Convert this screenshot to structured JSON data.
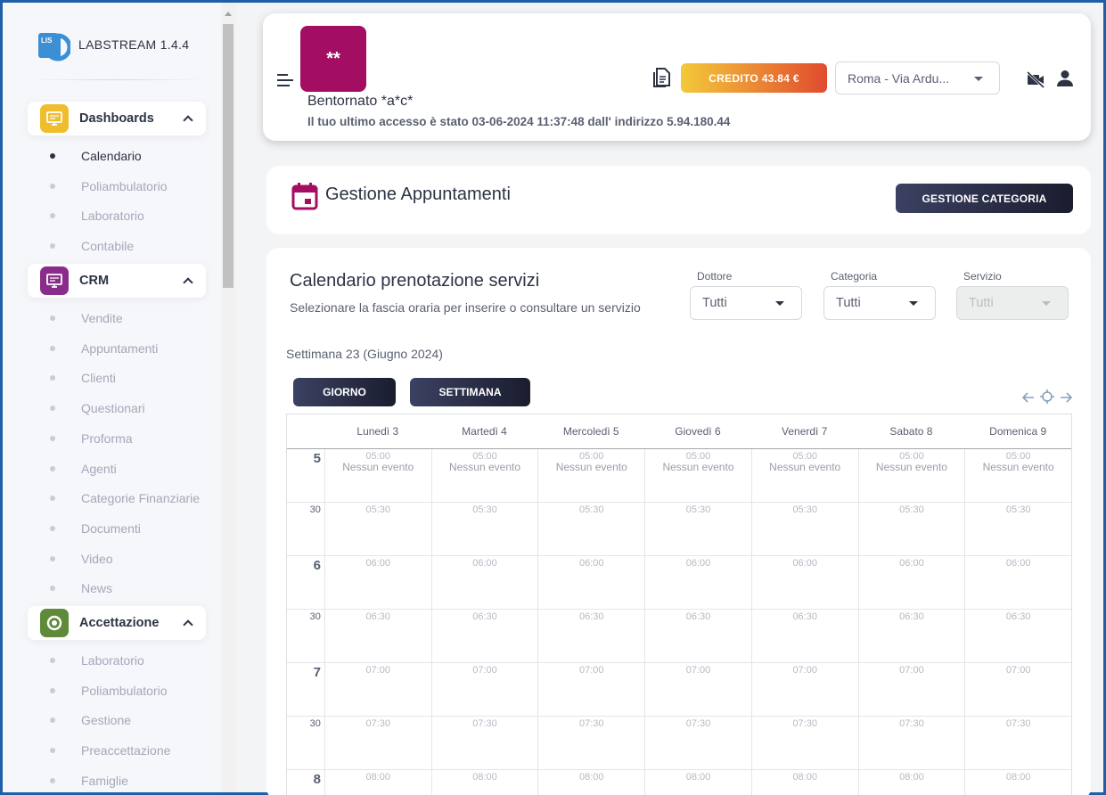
{
  "brand": {
    "name": "LABSTREAM 1.4.4",
    "logo_text": "LIS"
  },
  "sidebar": {
    "sections": [
      {
        "label": "Dashboards",
        "icon": "monitor-icon",
        "color": "#f0bd2e",
        "items": [
          "Calendario",
          "Poliambulatorio",
          "Laboratorio",
          "Contabile"
        ]
      },
      {
        "label": "CRM",
        "icon": "monitor-icon",
        "color": "#8a2c8c",
        "items": [
          "Vendite",
          "Appuntamenti",
          "Clienti",
          "Questionari",
          "Proforma",
          "Agenti",
          "Categorie Finanziarie",
          "Documenti",
          "Video",
          "News"
        ]
      },
      {
        "label": "Accettazione",
        "icon": "target-icon",
        "color": "#5e8a3a",
        "items": [
          "Laboratorio",
          "Poliambulatorio",
          "Gestione",
          "Preaccettazione",
          "Famiglie"
        ]
      }
    ],
    "active_item": "Calendario"
  },
  "header": {
    "avatar_text": "**",
    "welcome": "Bentornato *a*c*",
    "last_access": "Il tuo ultimo accesso è stato 03-06-2024 11:37:48 dall' indirizzo 5.94.180.44",
    "credit_label": "CREDITO 43.84 €",
    "location": "Roma - Via Ardu...",
    "avatar_color": "#a30e62"
  },
  "title_card": {
    "title": "Gestione Appuntamenti",
    "category_button": "GESTIONE CATEGORIA"
  },
  "calendar": {
    "title": "Calendario prenotazione servizi",
    "subtitle": "Selezionare la fascia oraria per inserire o consultare un servizio",
    "filters": [
      {
        "label": "Dottore",
        "value": "Tutti",
        "disabled": false
      },
      {
        "label": "Categoria",
        "value": "Tutti",
        "disabled": false
      },
      {
        "label": "Servizio",
        "value": "Tutti",
        "disabled": true
      }
    ],
    "week_label": "Settimana 23 (Giugno 2024)",
    "view_buttons": [
      "GIORNO",
      "SETTIMANA"
    ],
    "days": [
      "Lunedì 3",
      "Martedì 4",
      "Mercoledì 5",
      "Giovedì 6",
      "Venerdì 7",
      "Sabato 8",
      "Domenica 9"
    ],
    "no_event": "Nessun evento",
    "rows": [
      {
        "gutter": "5",
        "time": "05:00",
        "type": "hour"
      },
      {
        "gutter": "30",
        "time": "05:30",
        "type": "half"
      },
      {
        "gutter": "6",
        "time": "06:00",
        "type": "hour"
      },
      {
        "gutter": "30",
        "time": "06:30",
        "type": "half"
      },
      {
        "gutter": "7",
        "time": "07:00",
        "type": "hour"
      },
      {
        "gutter": "30",
        "time": "07:30",
        "type": "half"
      },
      {
        "gutter": "8",
        "time": "08:00",
        "type": "hour"
      }
    ]
  }
}
